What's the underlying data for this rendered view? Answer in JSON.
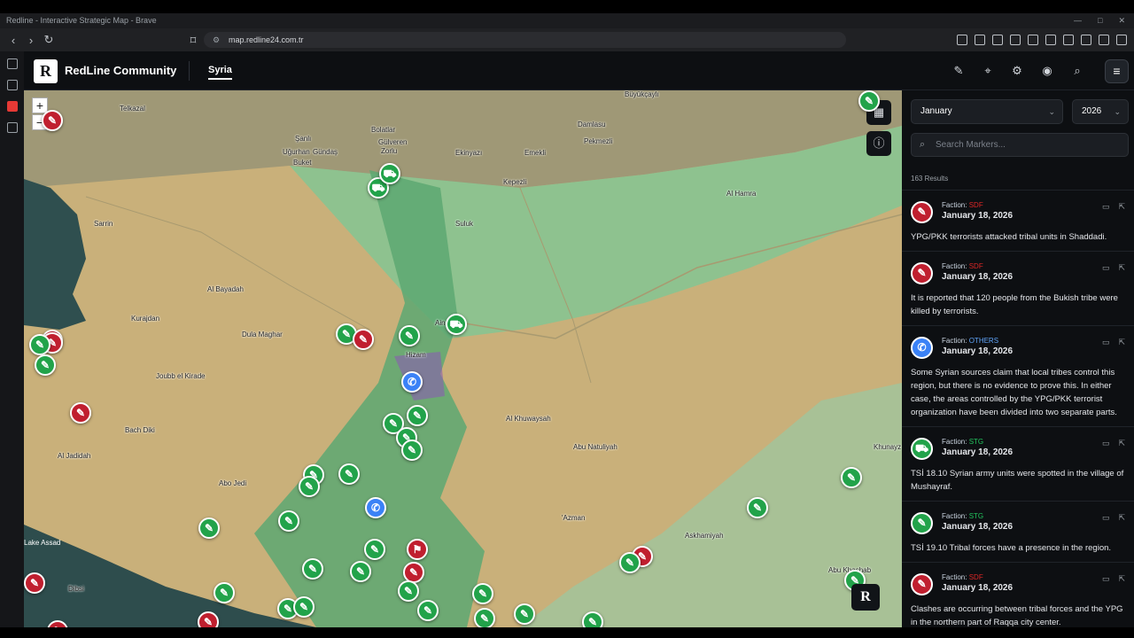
{
  "browser": {
    "title": "Redline - Interactive Strategic Map - Brave",
    "url": "map.redline24.com.tr",
    "back": "‹",
    "forward": "›",
    "reload": "↻"
  },
  "header": {
    "logo": "R",
    "brand": "RedLine Community",
    "nav": "Syria",
    "menu_icon": "≡"
  },
  "map": {
    "zoom_in": "+",
    "zoom_out": "−",
    "layers_icon": "▦",
    "info_icon": "ⓘ",
    "badge": "R",
    "places": [
      {
        "name": "Bolatlar"
      },
      {
        "name": "Gülveren"
      },
      {
        "name": "Zorlu"
      },
      {
        "name": "Şanlı"
      },
      {
        "name": "Uğurhan"
      },
      {
        "name": "Gündaş"
      },
      {
        "name": "Buket"
      },
      {
        "name": "Ekinyazı"
      },
      {
        "name": "Emekli"
      },
      {
        "name": "Pekmezli"
      },
      {
        "name": "Damlasu"
      },
      {
        "name": "Kepezli"
      },
      {
        "name": "Büyükçaylı"
      },
      {
        "name": "Telkazal"
      },
      {
        "name": "Sarrin"
      },
      {
        "name": "Al Bayadah"
      },
      {
        "name": "Dula Maghar"
      },
      {
        "name": "Kurajdan"
      },
      {
        "name": "Joubb el Kirade"
      },
      {
        "name": "Bach Diki"
      },
      {
        "name": "Al Jadidah"
      },
      {
        "name": "Abo Jedi"
      },
      {
        "name": "Lake Assad"
      },
      {
        "name": "Dibsi"
      },
      {
        "name": "Hizam"
      },
      {
        "name": "Al Khuwaysah"
      },
      {
        "name": "Abu Natuliyah"
      },
      {
        "name": "'Azman"
      },
      {
        "name": "Askhamiyah"
      },
      {
        "name": "Khunayz"
      },
      {
        "name": "Abu Khashab"
      },
      {
        "name": "Al Hamra"
      },
      {
        "name": "Suluk"
      },
      {
        "name": "Ain Issa"
      }
    ],
    "colors": {
      "sdf": "#c01f2f",
      "stg": "#22a34a",
      "others": "#3b82f6"
    }
  },
  "panel": {
    "month": "January",
    "year": "2026",
    "search_placeholder": "Search Markers...",
    "results": "163 Results",
    "items": [
      {
        "faction_label": "Faction:",
        "faction": "SDF",
        "faction_color": "#dc2626",
        "icon": "gun-icon",
        "date": "January 18, 2026",
        "text": "YPG/PKK terrorists attacked tribal units in Shaddadi."
      },
      {
        "faction_label": "Faction:",
        "faction": "SDF",
        "faction_color": "#dc2626",
        "icon": "gun-icon",
        "date": "January 18, 2026",
        "text": "It is reported that 120 people from the Bukish tribe were killed by terrorists."
      },
      {
        "faction_label": "Faction:",
        "faction": "OTHERS",
        "faction_color": "#60a5fa",
        "icon": "megaphone-icon",
        "date": "January 18, 2026",
        "text": "Some Syrian sources claim that local tribes control this region, but there is no evidence to prove this. In either case, the areas controlled by the YPG/PKK terrorist organization have been divided into two separate parts."
      },
      {
        "faction_label": "Faction:",
        "faction": "STG",
        "faction_color": "#22c55e",
        "icon": "truck-icon",
        "date": "January 18, 2026",
        "text": "TSİ 18.10 Syrian army units were spotted in the village of Mushayraf."
      },
      {
        "faction_label": "Faction:",
        "faction": "STG",
        "faction_color": "#22c55e",
        "icon": "gun-icon",
        "date": "January 18, 2026",
        "text": "TSİ 19.10 Tribal forces have a presence in the region."
      },
      {
        "faction_label": "Faction:",
        "faction": "SDF",
        "faction_color": "#dc2626",
        "icon": "gun-icon",
        "date": "January 18, 2026",
        "text": "Clashes are occurring between tribal forces and the YPG in the northern part of Raqqa city center."
      }
    ]
  }
}
